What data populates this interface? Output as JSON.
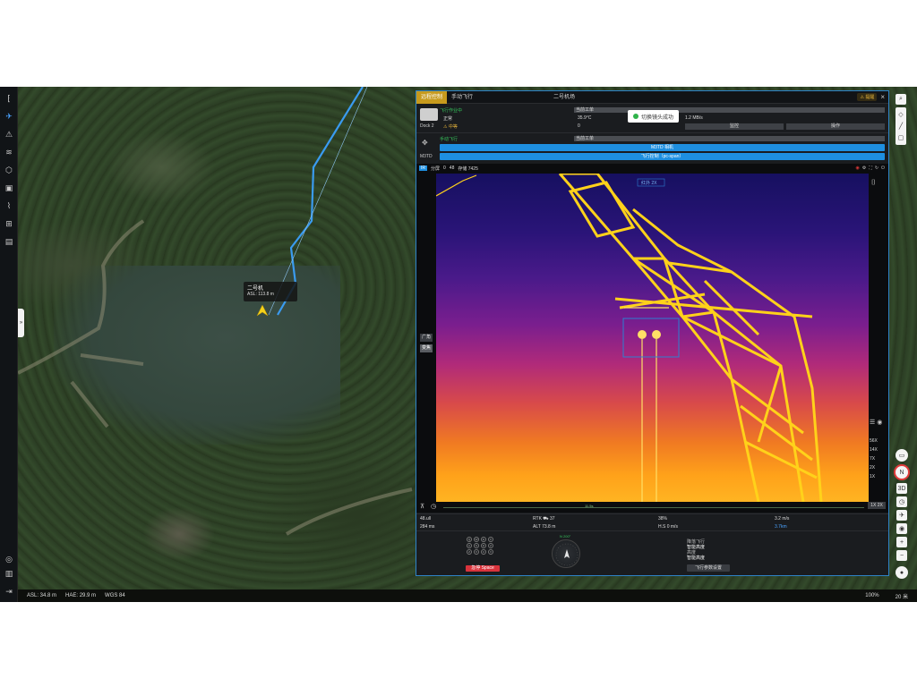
{
  "panel": {
    "tabs": [
      "远程控制",
      "手动飞行",
      "二号机场"
    ],
    "active_tab": 0,
    "flag": "⚠ 提醒",
    "close": "×"
  },
  "dock": {
    "name": "Dock 2",
    "status": "飞行作业中",
    "mode": "正常",
    "state": "⚠ 中等",
    "work_tag": "当前工单",
    "temperature": "35.9°C",
    "zero": "0",
    "network": "1.2 MB/s",
    "monitor_btn": "监控",
    "operate_btn": "操作"
  },
  "drone": {
    "name": "M3TD",
    "mode": "手动飞行",
    "work_tag": "当前工单",
    "camera_btn": "M3TD 相机",
    "flight_control_btn": "飞行控制（pc-span）"
  },
  "toast": {
    "text": "切换镜头成功"
  },
  "video": {
    "ir_tag": "IR",
    "label_sep": "分屏",
    "count_label": "0",
    "count_max": "48",
    "storage": "存储 7425",
    "lens_tabs": [
      "广角",
      "变焦"
    ],
    "active_lens": 1,
    "zoom_levels": [
      "56X",
      "14X",
      "7X",
      "2X",
      "1X"
    ],
    "zoom_readout": "1X 2X",
    "track_label": "11.5s",
    "box_label": "红外 2X"
  },
  "telemetry": {
    "signal": "48.ull",
    "delay": "284 ms",
    "rtk": "RTK ⛟ 37",
    "alt": "ALT 73.8 m",
    "battery": "38%",
    "hs": "H.S 0 m/s",
    "wind": "3.2 m/s",
    "distance": "3.7km"
  },
  "controls": {
    "keys_top": [
      "Q",
      "W",
      "E",
      "C"
    ],
    "keys_mid": [
      "A",
      "S",
      "D",
      "Z"
    ],
    "keys_bottom": [
      "Z",
      "X",
      "C",
      "V"
    ],
    "emergency": "急停 Space",
    "compass_heading": "N 200°",
    "flight_mode_label": "降落飞行",
    "flight_mode_value": "智能高度",
    "height_label": "高度",
    "height_value": "智能高度",
    "param_btn": "飞行参数设置"
  },
  "map": {
    "drone_name": "二号机",
    "drone_asl": "ASL: 113.8 m"
  },
  "status_bar": {
    "asl": "ASL: 34.8 m",
    "hae": "HAE: 29.9 m",
    "wgs": "WGS 84",
    "zoom": "100%",
    "scale": "20 米"
  }
}
